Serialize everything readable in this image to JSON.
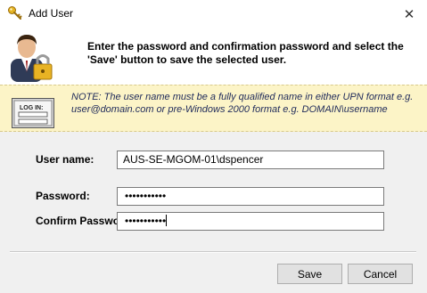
{
  "window": {
    "title": "Add User",
    "close_glyph": "✕"
  },
  "header": {
    "instruction": "Enter the password and confirmation password and select the 'Save' button to save the selected user.",
    "icon": "user-with-lock-icon"
  },
  "note": {
    "text": "NOTE:  The user name must be a fully qualified name in either UPN format e.g. user@domain.com or pre-Windows 2000 format e.g. DOMAIN\\username",
    "icon": "login-screen-icon",
    "icon_text": "LOG IN:",
    "background": "#fcf4c7"
  },
  "form": {
    "username_label": "User name:",
    "username_value": "AUS-SE-MGOM-01\\dspencer",
    "password_label": "Password:",
    "password_value": "•••••••••••",
    "confirm_label": "Confirm Password:",
    "confirm_value": "•••••••••••"
  },
  "buttons": {
    "save": "Save",
    "cancel": "Cancel"
  }
}
